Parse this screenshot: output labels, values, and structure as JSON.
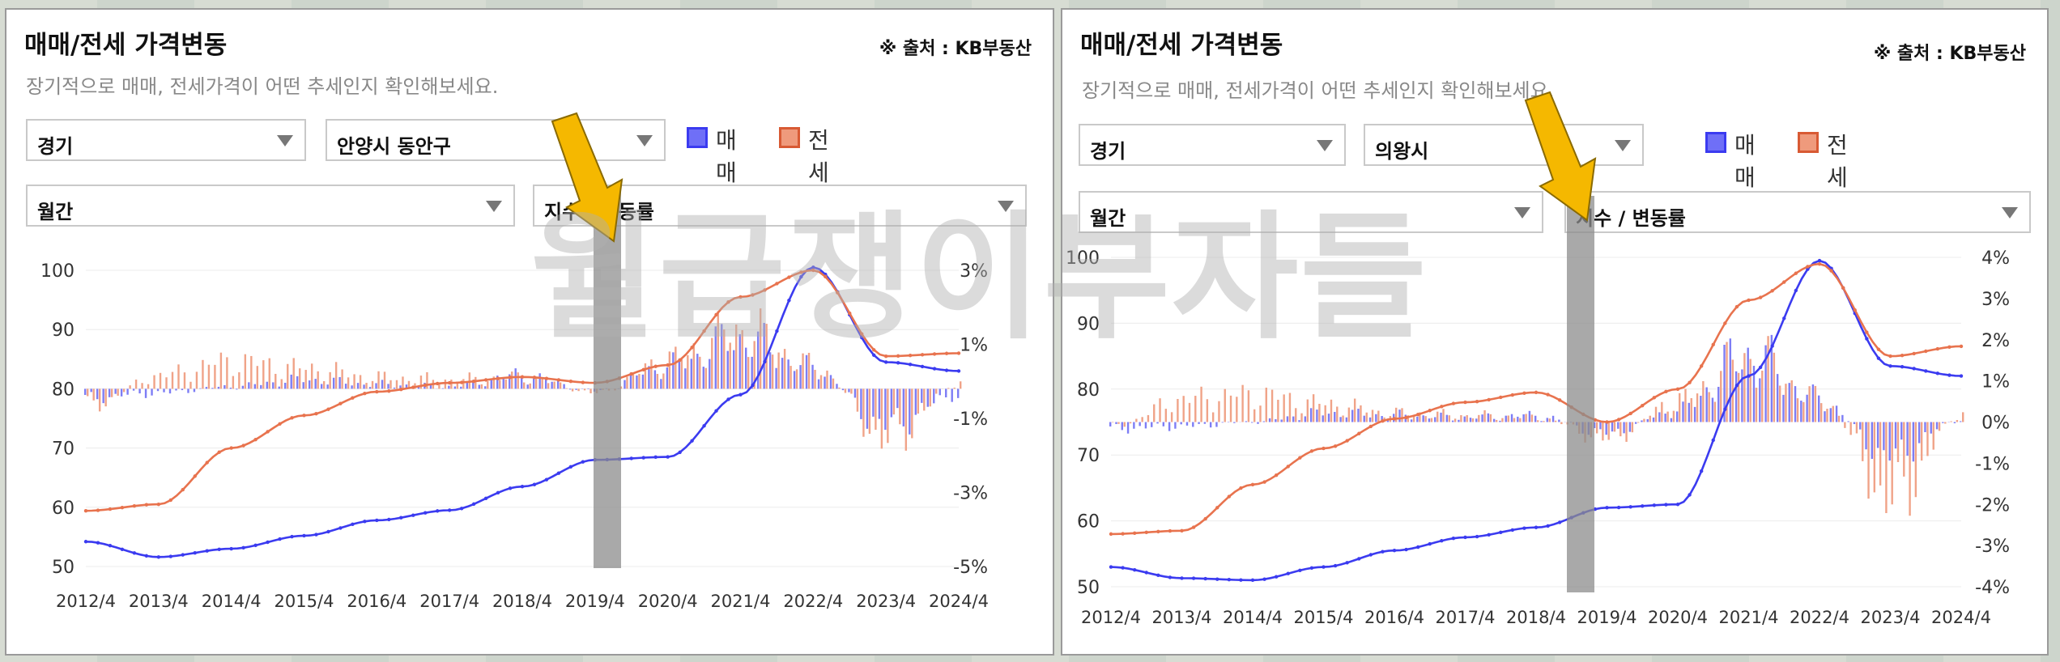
{
  "watermark": "월급쟁이부자들",
  "colors": {
    "sale": "#3b3bf0",
    "jeonse": "#e8734e",
    "highlight": "#8c8c8c",
    "arrow": "#f5b800"
  },
  "panels": [
    {
      "title": "매매/전세 가격변동",
      "source": "※ 출처 : KB부동산",
      "subtitle": "장기적으로 매매, 전세가격이 어떤 추세인지 확인해보세요.",
      "region_select": "경기",
      "city_select": "안양시 동안구",
      "period_select": "월간",
      "metric_select": "지수 / 변동률",
      "legend_sale": "매매",
      "legend_jeonse": "전세"
    },
    {
      "title": "매매/전세 가격변동",
      "source": "※ 출처 : KB부동산",
      "subtitle": "장기적으로 매매, 전세가격이 어떤 추세인지 확인해보세요.",
      "region_select": "경기",
      "city_select": "의왕시",
      "period_select": "월간",
      "metric_select": "지수 / 변동률",
      "legend_sale": "매매",
      "legend_jeonse": "전세"
    }
  ],
  "chart_data": [
    {
      "type": "line",
      "region": "안양시 동안구",
      "x": [
        "2012/4",
        "2013/4",
        "2014/4",
        "2015/4",
        "2016/4",
        "2017/4",
        "2018/4",
        "2019/4",
        "2020/4",
        "2021/4",
        "2022/4",
        "2023/4",
        "2024/4"
      ],
      "ylim": [
        50,
        100
      ],
      "yticks": [
        100,
        90,
        80,
        70,
        60,
        50
      ],
      "y2lim": [
        -0.05,
        0.04
      ],
      "y2ticks": [
        "3%",
        "1%",
        "-1%",
        "-3%",
        "-5%"
      ],
      "series": [
        {
          "name": "매매",
          "values": [
            54.2,
            51.6,
            53.0,
            55.2,
            57.8,
            59.5,
            63.5,
            68.0,
            68.5,
            79.0,
            100.5,
            84.5,
            83.0
          ]
        },
        {
          "name": "전세",
          "values": [
            59.4,
            60.5,
            70.0,
            75.5,
            79.5,
            81.0,
            82.0,
            81.0,
            84.0,
            95.5,
            100.0,
            85.5,
            86.0
          ]
        }
      ],
      "rate_series": [
        {
          "name": "매매",
          "values": [
            -0.4,
            -0.2,
            0.1,
            0.4,
            0.2,
            0.1,
            0.6,
            -0.1,
            1.0,
            2.2,
            0.9,
            -1.6,
            -0.3
          ]
        },
        {
          "name": "전세",
          "values": [
            -0.8,
            0.6,
            1.2,
            0.9,
            0.5,
            0.4,
            0.5,
            -0.2,
            1.3,
            2.6,
            1.0,
            -2.3,
            0.3
          ]
        }
      ],
      "highlight": "2019/4"
    },
    {
      "type": "line",
      "region": "의왕시",
      "x": [
        "2012/4",
        "2013/4",
        "2014/4",
        "2015/4",
        "2016/4",
        "2017/4",
        "2018/4",
        "2019/4",
        "2020/4",
        "2021/4",
        "2022/4",
        "2023/4",
        "2024/4"
      ],
      "ylim": [
        50,
        100
      ],
      "yticks": [
        100,
        90,
        80,
        70,
        60,
        50
      ],
      "y2lim": [
        -0.04,
        0.04
      ],
      "y2ticks": [
        "4%",
        "3%",
        "2%",
        "1%",
        "0%",
        "-1%",
        "-2%",
        "-3%",
        "-4%"
      ],
      "series": [
        {
          "name": "매매",
          "values": [
            53.0,
            51.3,
            51.0,
            53.0,
            55.5,
            57.5,
            59.0,
            62.0,
            62.5,
            82.0,
            99.5,
            83.5,
            82.0
          ]
        },
        {
          "name": "전세",
          "values": [
            58.0,
            58.5,
            65.5,
            71.0,
            75.5,
            78.0,
            79.5,
            75.0,
            80.0,
            93.5,
            99.0,
            85.0,
            86.5
          ]
        }
      ],
      "rate_series": [
        {
          "name": "매매",
          "values": [
            -0.3,
            -0.2,
            0.0,
            0.4,
            0.3,
            0.2,
            0.3,
            -0.5,
            0.5,
            3.0,
            1.0,
            -1.5,
            0.1
          ]
        },
        {
          "name": "전세",
          "values": [
            -0.2,
            1.0,
            1.2,
            0.8,
            0.4,
            0.3,
            0.2,
            -0.8,
            1.0,
            2.8,
            1.0,
            -3.5,
            0.4
          ]
        }
      ],
      "highlight": "2019/4"
    }
  ]
}
